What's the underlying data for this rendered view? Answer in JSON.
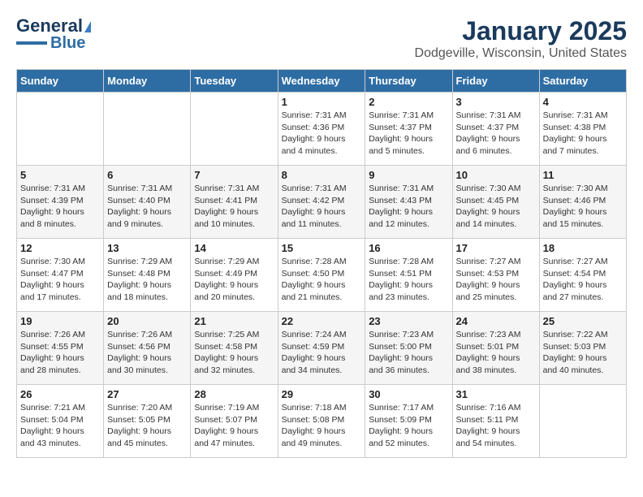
{
  "header": {
    "logo_line1": "General",
    "logo_line2": "Blue",
    "title": "January 2025",
    "subtitle": "Dodgeville, Wisconsin, United States"
  },
  "weekdays": [
    "Sunday",
    "Monday",
    "Tuesday",
    "Wednesday",
    "Thursday",
    "Friday",
    "Saturday"
  ],
  "weeks": [
    [
      {
        "day": "",
        "info": ""
      },
      {
        "day": "",
        "info": ""
      },
      {
        "day": "",
        "info": ""
      },
      {
        "day": "1",
        "info": "Sunrise: 7:31 AM\nSunset: 4:36 PM\nDaylight: 9 hours\nand 4 minutes."
      },
      {
        "day": "2",
        "info": "Sunrise: 7:31 AM\nSunset: 4:37 PM\nDaylight: 9 hours\nand 5 minutes."
      },
      {
        "day": "3",
        "info": "Sunrise: 7:31 AM\nSunset: 4:37 PM\nDaylight: 9 hours\nand 6 minutes."
      },
      {
        "day": "4",
        "info": "Sunrise: 7:31 AM\nSunset: 4:38 PM\nDaylight: 9 hours\nand 7 minutes."
      }
    ],
    [
      {
        "day": "5",
        "info": "Sunrise: 7:31 AM\nSunset: 4:39 PM\nDaylight: 9 hours\nand 8 minutes."
      },
      {
        "day": "6",
        "info": "Sunrise: 7:31 AM\nSunset: 4:40 PM\nDaylight: 9 hours\nand 9 minutes."
      },
      {
        "day": "7",
        "info": "Sunrise: 7:31 AM\nSunset: 4:41 PM\nDaylight: 9 hours\nand 10 minutes."
      },
      {
        "day": "8",
        "info": "Sunrise: 7:31 AM\nSunset: 4:42 PM\nDaylight: 9 hours\nand 11 minutes."
      },
      {
        "day": "9",
        "info": "Sunrise: 7:31 AM\nSunset: 4:43 PM\nDaylight: 9 hours\nand 12 minutes."
      },
      {
        "day": "10",
        "info": "Sunrise: 7:30 AM\nSunset: 4:45 PM\nDaylight: 9 hours\nand 14 minutes."
      },
      {
        "day": "11",
        "info": "Sunrise: 7:30 AM\nSunset: 4:46 PM\nDaylight: 9 hours\nand 15 minutes."
      }
    ],
    [
      {
        "day": "12",
        "info": "Sunrise: 7:30 AM\nSunset: 4:47 PM\nDaylight: 9 hours\nand 17 minutes."
      },
      {
        "day": "13",
        "info": "Sunrise: 7:29 AM\nSunset: 4:48 PM\nDaylight: 9 hours\nand 18 minutes."
      },
      {
        "day": "14",
        "info": "Sunrise: 7:29 AM\nSunset: 4:49 PM\nDaylight: 9 hours\nand 20 minutes."
      },
      {
        "day": "15",
        "info": "Sunrise: 7:28 AM\nSunset: 4:50 PM\nDaylight: 9 hours\nand 21 minutes."
      },
      {
        "day": "16",
        "info": "Sunrise: 7:28 AM\nSunset: 4:51 PM\nDaylight: 9 hours\nand 23 minutes."
      },
      {
        "day": "17",
        "info": "Sunrise: 7:27 AM\nSunset: 4:53 PM\nDaylight: 9 hours\nand 25 minutes."
      },
      {
        "day": "18",
        "info": "Sunrise: 7:27 AM\nSunset: 4:54 PM\nDaylight: 9 hours\nand 27 minutes."
      }
    ],
    [
      {
        "day": "19",
        "info": "Sunrise: 7:26 AM\nSunset: 4:55 PM\nDaylight: 9 hours\nand 28 minutes."
      },
      {
        "day": "20",
        "info": "Sunrise: 7:26 AM\nSunset: 4:56 PM\nDaylight: 9 hours\nand 30 minutes."
      },
      {
        "day": "21",
        "info": "Sunrise: 7:25 AM\nSunset: 4:58 PM\nDaylight: 9 hours\nand 32 minutes."
      },
      {
        "day": "22",
        "info": "Sunrise: 7:24 AM\nSunset: 4:59 PM\nDaylight: 9 hours\nand 34 minutes."
      },
      {
        "day": "23",
        "info": "Sunrise: 7:23 AM\nSunset: 5:00 PM\nDaylight: 9 hours\nand 36 minutes."
      },
      {
        "day": "24",
        "info": "Sunrise: 7:23 AM\nSunset: 5:01 PM\nDaylight: 9 hours\nand 38 minutes."
      },
      {
        "day": "25",
        "info": "Sunrise: 7:22 AM\nSunset: 5:03 PM\nDaylight: 9 hours\nand 40 minutes."
      }
    ],
    [
      {
        "day": "26",
        "info": "Sunrise: 7:21 AM\nSunset: 5:04 PM\nDaylight: 9 hours\nand 43 minutes."
      },
      {
        "day": "27",
        "info": "Sunrise: 7:20 AM\nSunset: 5:05 PM\nDaylight: 9 hours\nand 45 minutes."
      },
      {
        "day": "28",
        "info": "Sunrise: 7:19 AM\nSunset: 5:07 PM\nDaylight: 9 hours\nand 47 minutes."
      },
      {
        "day": "29",
        "info": "Sunrise: 7:18 AM\nSunset: 5:08 PM\nDaylight: 9 hours\nand 49 minutes."
      },
      {
        "day": "30",
        "info": "Sunrise: 7:17 AM\nSunset: 5:09 PM\nDaylight: 9 hours\nand 52 minutes."
      },
      {
        "day": "31",
        "info": "Sunrise: 7:16 AM\nSunset: 5:11 PM\nDaylight: 9 hours\nand 54 minutes."
      },
      {
        "day": "",
        "info": ""
      }
    ]
  ]
}
